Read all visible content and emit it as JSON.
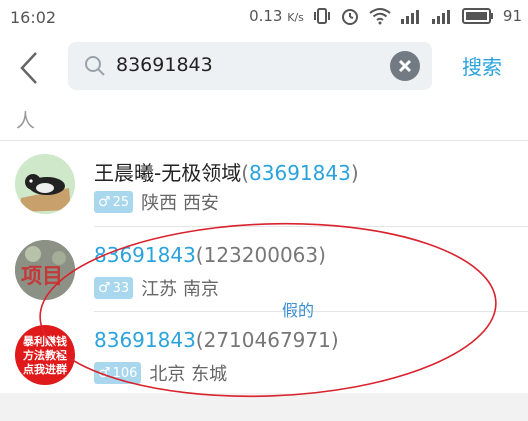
{
  "status_bar": {
    "time": "16:02",
    "speed": "0.13",
    "speed_unit": "K/s",
    "battery": "91"
  },
  "search": {
    "query": "83691843",
    "submit_label": "搜索"
  },
  "section_label": "人",
  "results": [
    {
      "name": "王晨曦-无极领域",
      "number": "83691843",
      "age": "25",
      "gender_symbol": "♂",
      "location": "陕西 西安"
    },
    {
      "name": "",
      "number": "83691843",
      "alias": "123200063",
      "age": "33",
      "gender_symbol": "♂",
      "location": "江苏 南京",
      "avatar_text": "项目"
    },
    {
      "name": "",
      "number": "83691843",
      "alias": "2710467971",
      "age": "106",
      "gender_symbol": "♂",
      "location": "北京 东城",
      "avatar_lines": [
        "暴利赚钱",
        "方法教程",
        "点我进群"
      ]
    }
  ],
  "annotation": {
    "text": "假的",
    "color": "#d9232d"
  },
  "colors": {
    "accent": "#2aa3dd",
    "badge": "#a9d8ee"
  }
}
